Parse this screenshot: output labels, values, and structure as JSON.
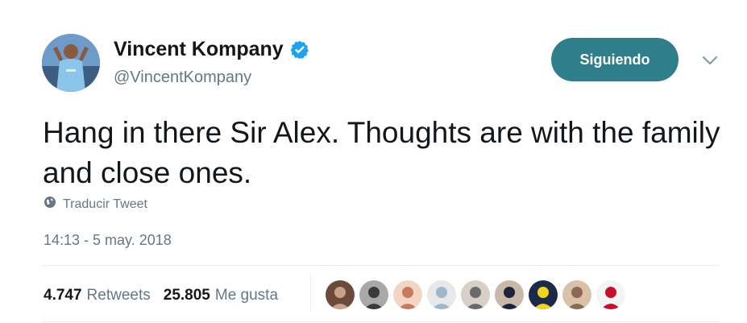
{
  "tweet": {
    "display_name": "Vincent Kompany",
    "handle": "@VincentKompany",
    "verified": true,
    "text": "Hang in there Sir Alex. Thoughts are with the family and close ones.",
    "translate_label": "Traducir Tweet",
    "timestamp": "14:13 - 5 may. 2018"
  },
  "actions": {
    "follow_label": "Siguiendo"
  },
  "stats": {
    "retweets_count": "4.747",
    "retweets_label": "Retweets",
    "likes_count": "25.805",
    "likes_label": "Me gusta"
  },
  "likers": [
    {
      "color_a": "#c9a18a",
      "color_b": "#6b4a3c"
    },
    {
      "color_a": "#3a3a3a",
      "color_b": "#a8a8a8"
    },
    {
      "color_a": "#c77a5e",
      "color_b": "#f2d6c4"
    },
    {
      "color_a": "#9fb7c9",
      "color_b": "#e8e8e8"
    },
    {
      "color_a": "#6a6a6a",
      "color_b": "#d8cfc6"
    },
    {
      "color_a": "#1b2438",
      "color_b": "#c9b8a8"
    },
    {
      "color_a": "#f2d21b",
      "color_b": "#1b2a4a"
    },
    {
      "color_a": "#8a6a55",
      "color_b": "#d9c2a8"
    },
    {
      "color_a": "#c8102e",
      "color_b": "#f4f4f4"
    }
  ],
  "colors": {
    "accent": "#1da1f2",
    "follow_bg": "#2f7e8c",
    "muted_text": "#657786",
    "divider": "#e6ecf0"
  }
}
